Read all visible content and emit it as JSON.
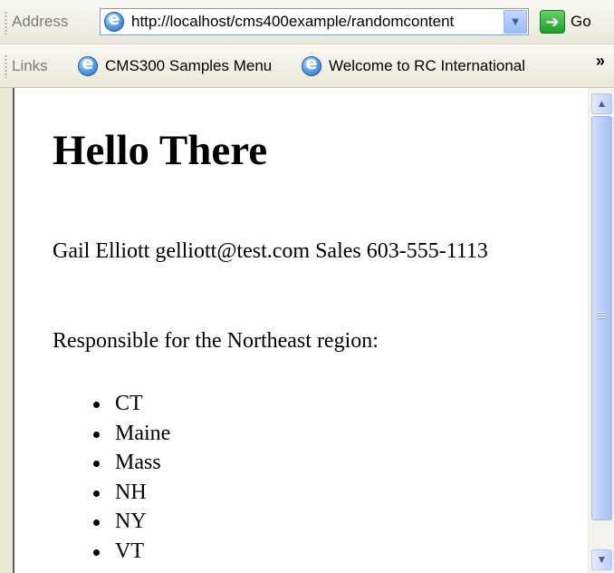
{
  "address_bar": {
    "label": "Address",
    "url": "http://localhost/cms400example/randomcontent",
    "go_label": "Go"
  },
  "links_bar": {
    "label": "Links",
    "items": [
      {
        "label": "CMS300 Samples Menu"
      },
      {
        "label": "Welcome to RC International"
      }
    ],
    "overflow": "»"
  },
  "page": {
    "title": "Hello There",
    "contact": "Gail Elliott gelliott@test.com Sales 603-555-1113",
    "region_intro": "Responsible for the Northeast region:",
    "states": [
      "CT",
      "Maine",
      "Mass",
      "NH",
      "NY",
      "VT"
    ]
  },
  "icons": {
    "page_icon": "internet-explorer-icon",
    "go_icon": "green-arrow-right-icon",
    "dropdown_icon": "chevron-down-icon"
  },
  "colors": {
    "toolbar_bg": "#ebe9db",
    "scrollbar_thumb": "#b6cbf8",
    "go_button": "#2ea83a"
  }
}
